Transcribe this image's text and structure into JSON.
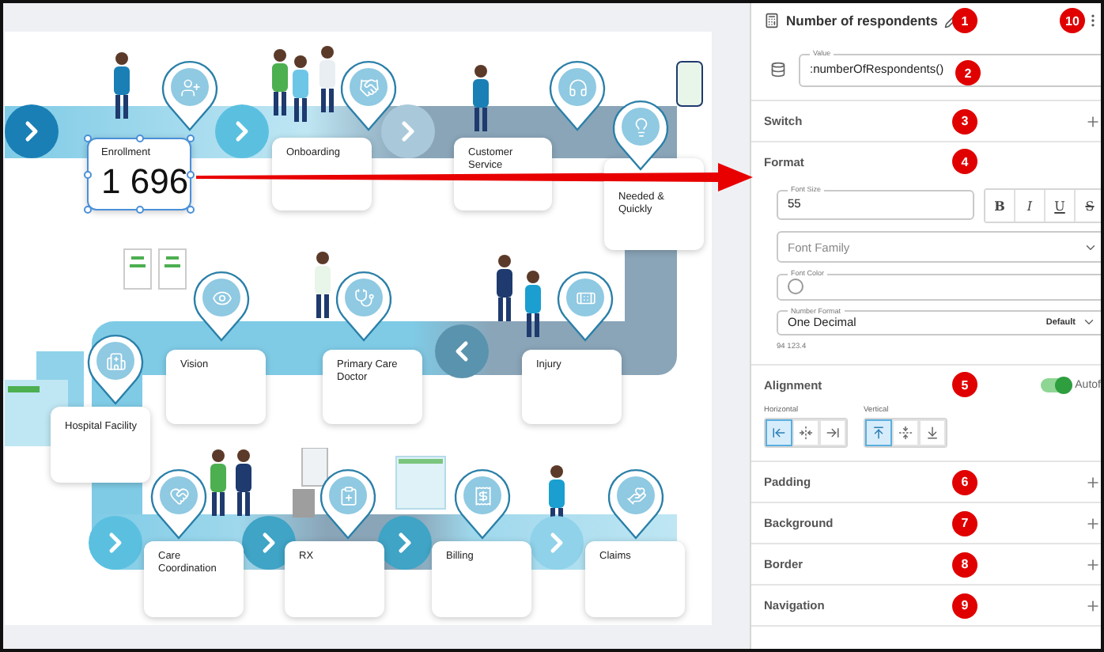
{
  "canvas": {
    "stages": [
      {
        "label": "Enrollment",
        "value": "1 696",
        "selected": true
      },
      {
        "label": "Onboarding",
        "selected": false
      },
      {
        "label": "Customer Service",
        "selected": false
      },
      {
        "label": "Needed & Quickly",
        "selected": false
      },
      {
        "label": "Hospital Facility",
        "selected": false
      },
      {
        "label": "Vision",
        "selected": false
      },
      {
        "label": "Primary Care Doctor",
        "selected": false
      },
      {
        "label": "Injury",
        "selected": false
      },
      {
        "label": "Care Coordination",
        "selected": false
      },
      {
        "label": "RX",
        "selected": false
      },
      {
        "label": "Billing",
        "selected": false
      },
      {
        "label": "Claims",
        "selected": false
      }
    ]
  },
  "panel": {
    "title": "Number of respondents",
    "title_badge": "1",
    "menu_badge": "10",
    "value_field": {
      "label": "Value",
      "value": ":numberOfRespondents()",
      "badge": "2"
    },
    "sections": [
      {
        "kind": "plain",
        "title": "Switch",
        "badge": "3",
        "expanded": false
      },
      {
        "kind": "format",
        "title": "Format",
        "badge": "4",
        "expanded": true
      },
      {
        "kind": "alignment",
        "title": "Alignment",
        "badge": "5",
        "expanded": true
      },
      {
        "kind": "plain",
        "title": "Padding",
        "badge": "6",
        "expanded": false
      },
      {
        "kind": "plain",
        "title": "Background",
        "badge": "7",
        "expanded": false
      },
      {
        "kind": "plain",
        "title": "Border",
        "badge": "8",
        "expanded": false
      },
      {
        "kind": "plain",
        "title": "Navigation",
        "badge": "9",
        "expanded": false
      }
    ],
    "format": {
      "font_size": {
        "label": "Font Size",
        "value": "55"
      },
      "style_buttons": [
        {
          "kind": "bold",
          "label": "B",
          "on": false
        },
        {
          "kind": "italic",
          "label": "I",
          "on": false
        },
        {
          "kind": "underline",
          "label": "U",
          "on": false
        },
        {
          "kind": "strike",
          "label": "S",
          "on": false
        }
      ],
      "font_family": {
        "placeholder": "Font Family"
      },
      "font_color": {
        "label": "Font Color"
      },
      "number_format": {
        "label": "Number Format",
        "value": "One Decimal",
        "tag": "Default"
      },
      "example": "94 123.4"
    },
    "alignment": {
      "auto_fit": {
        "label": "Autof",
        "on": true
      },
      "horizontal": {
        "label": "Horizontal",
        "options": [
          {
            "kind": "left",
            "selected": true
          },
          {
            "kind": "center",
            "selected": false
          },
          {
            "kind": "right",
            "selected": false
          }
        ]
      },
      "vertical": {
        "label": "Vertical",
        "options": [
          {
            "kind": "top",
            "selected": true
          },
          {
            "kind": "middle",
            "selected": false
          },
          {
            "kind": "bottom",
            "selected": false
          }
        ]
      }
    }
  }
}
